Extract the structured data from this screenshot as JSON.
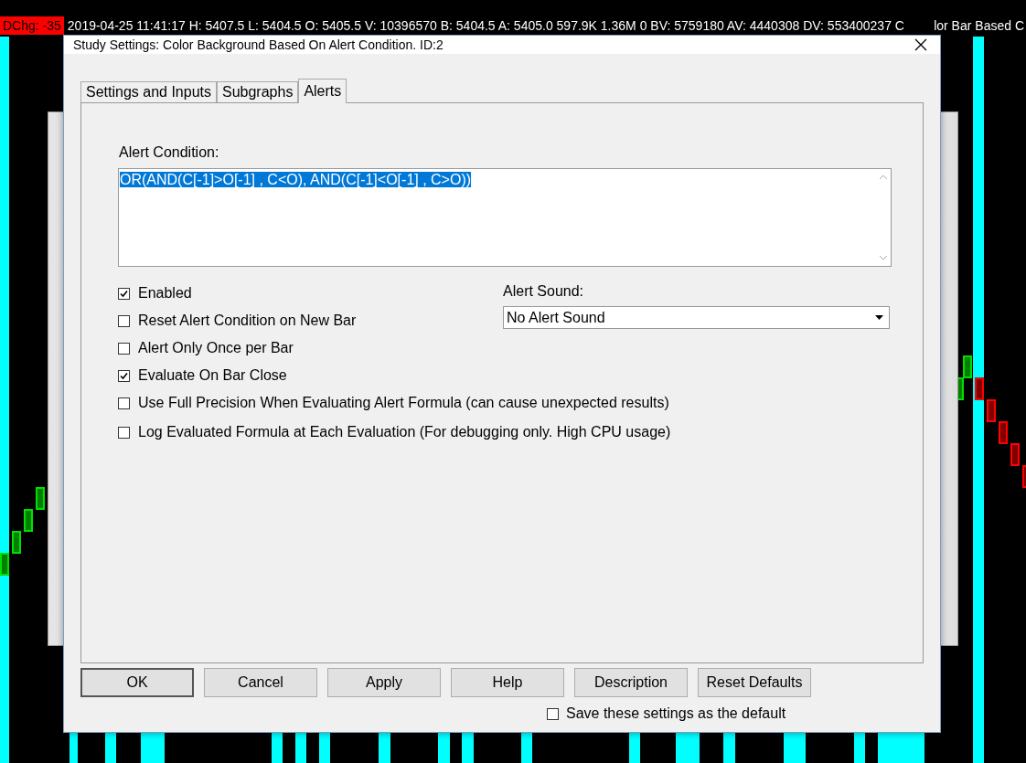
{
  "chart_header": {
    "change_label": "DChg: -35",
    "info": "2019-04-25 11:41:17 H: 5407.5 L: 5404.5 O: 5405.5 V: 10396570 B: 5404.5 A: 5405.0 597.9K 1.36M 0 BV: 5759180 AV: 4440308 DV: 553400237 C",
    "study_name": "lor Bar Based C"
  },
  "window": {
    "title": "Study Settings: Color Background Based On Alert Condition. ID:2"
  },
  "tabs": [
    {
      "label": "Settings and Inputs",
      "selected": false
    },
    {
      "label": "Subgraphs",
      "selected": false
    },
    {
      "label": "Alerts",
      "selected": true
    }
  ],
  "alert_condition": {
    "label": "Alert Condition:",
    "value": "OR(AND(C[-1]>O[-1] , C<O), AND(C[-1]<O[-1] , C>O))",
    "selected": true
  },
  "options": [
    {
      "label": "Enabled",
      "checked": true
    },
    {
      "label": "Reset Alert Condition on New Bar",
      "checked": false
    },
    {
      "label": "Alert Only Once per Bar",
      "checked": false
    },
    {
      "label": "Evaluate On Bar Close",
      "checked": true
    },
    {
      "label": "Use Full Precision When Evaluating Alert Formula (can cause unexpected results)",
      "checked": false
    },
    {
      "label": "Log Evaluated Formula at Each Evaluation (For debugging only. High CPU usage)",
      "checked": false
    }
  ],
  "alert_sound": {
    "label": "Alert Sound:",
    "value": "No Alert Sound"
  },
  "buttons": [
    "OK",
    "Cancel",
    "Apply",
    "Help",
    "Description",
    "Reset Defaults"
  ],
  "save_default": {
    "label": "Save these settings as the default",
    "checked": false
  }
}
